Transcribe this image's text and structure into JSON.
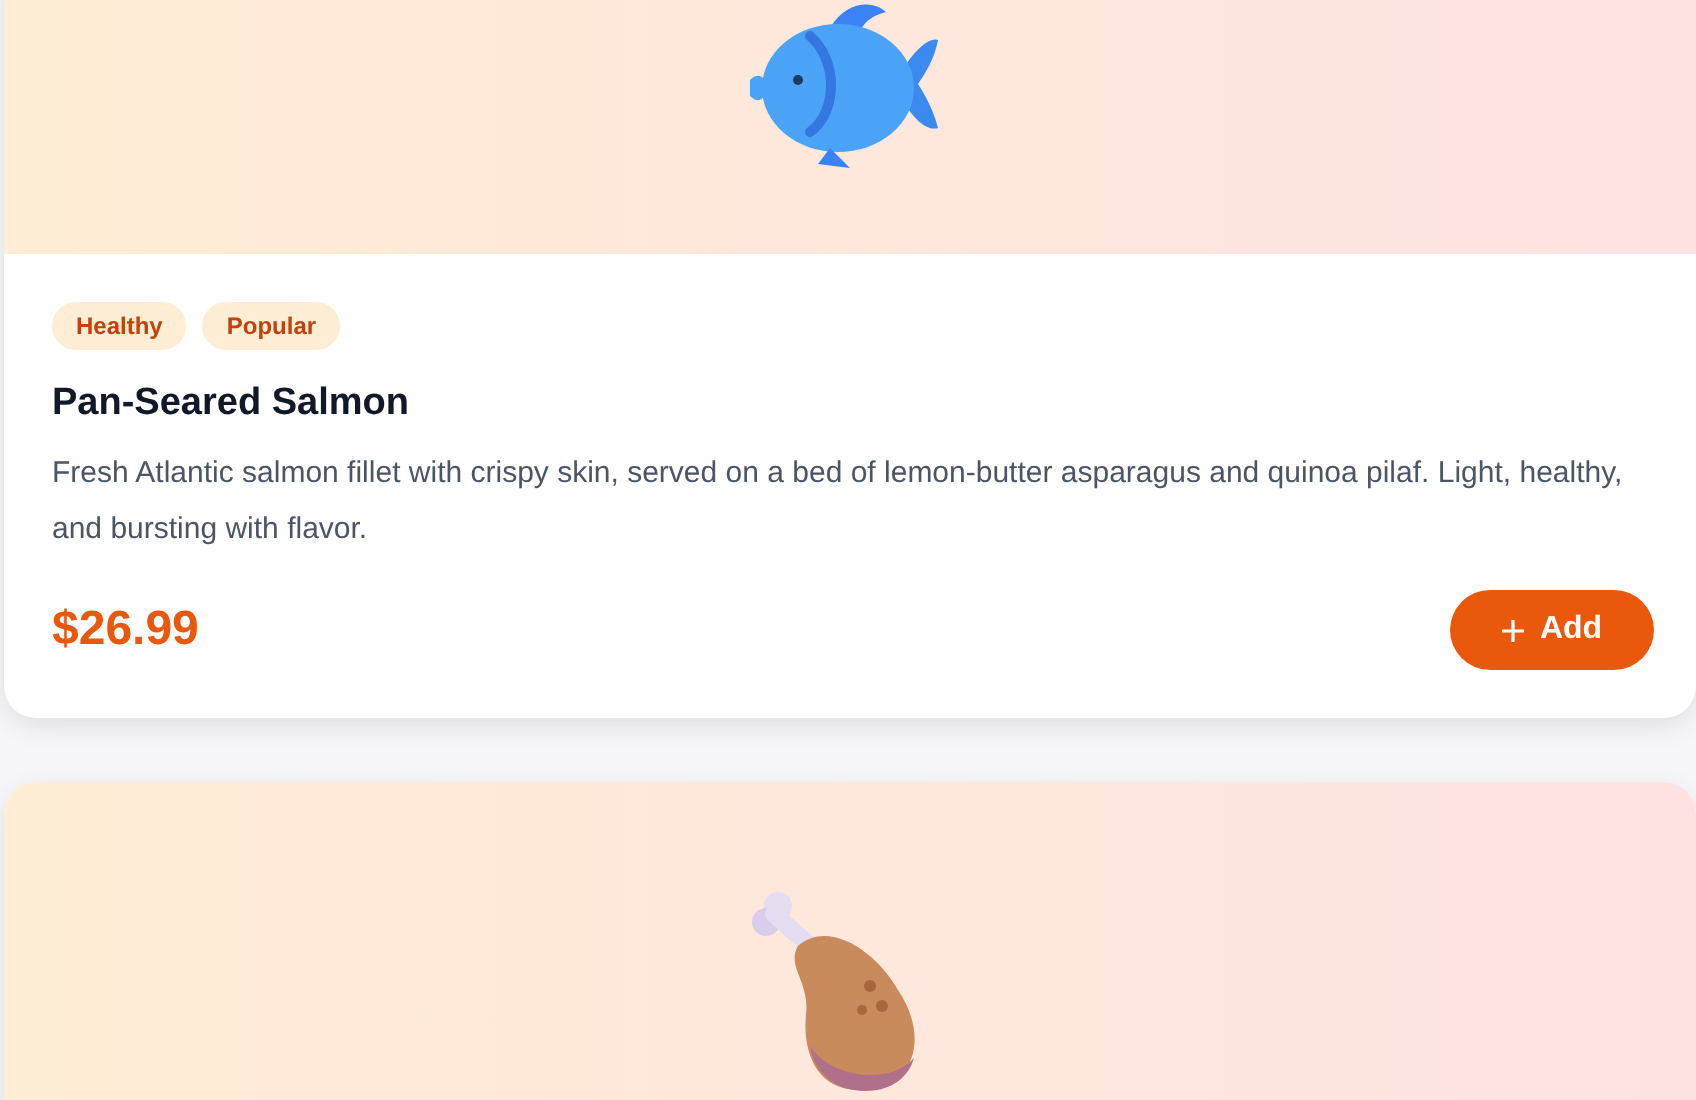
{
  "cards": [
    {
      "kind": "fish",
      "tags": [
        "Healthy",
        "Popular"
      ],
      "title": "Pan-Seared Salmon",
      "description": "Fresh Atlantic salmon fillet with crispy skin, served on a bed of lemon-butter asparagus and quinoa pilaf. Light, healthy, and bursting with flavor.",
      "price": "$26.99",
      "button": "Add"
    },
    {
      "kind": "drumstick"
    }
  ]
}
